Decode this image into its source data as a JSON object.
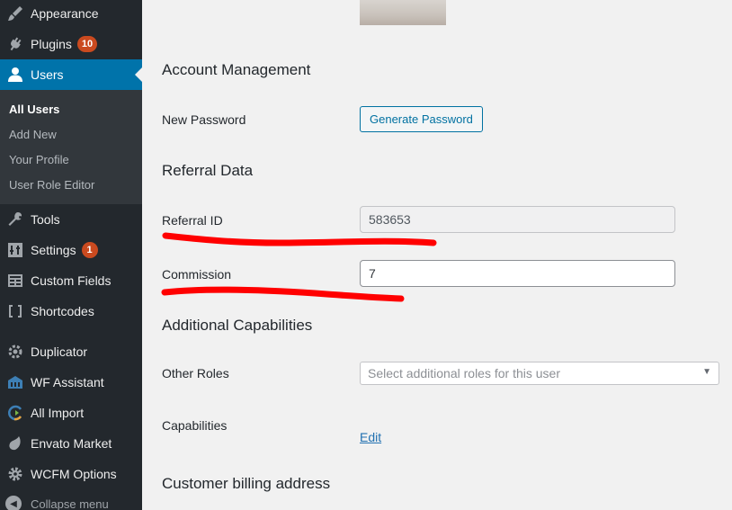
{
  "sidebar": {
    "items": [
      {
        "label": "Appearance",
        "icon": "paintbrush-icon"
      },
      {
        "label": "Plugins",
        "icon": "plugin-icon",
        "badge": "10"
      },
      {
        "label": "Users",
        "icon": "user-icon"
      },
      {
        "label": "Tools",
        "icon": "wrench-icon"
      },
      {
        "label": "Settings",
        "icon": "settings-icon",
        "badge": "1"
      },
      {
        "label": "Custom Fields",
        "icon": "table-icon"
      },
      {
        "label": "Shortcodes",
        "icon": "brackets-icon"
      },
      {
        "label": "Duplicator",
        "icon": "gear-icon"
      },
      {
        "label": "WF Assistant",
        "icon": "building-icon"
      },
      {
        "label": "All Import",
        "icon": "import-icon"
      },
      {
        "label": "Envato Market",
        "icon": "leaf-icon"
      },
      {
        "label": "WCFM Options",
        "icon": "cog-icon"
      }
    ],
    "submenu": [
      "All Users",
      "Add New",
      "Your Profile",
      "User Role Editor"
    ],
    "collapse_label": "Collapse menu"
  },
  "content": {
    "account_heading": "Account Management",
    "new_password_label": "New Password",
    "generate_password_button": "Generate Password",
    "referral_heading": "Referral Data",
    "referral_id_label": "Referral ID",
    "referral_id_value": "583653",
    "commission_label": "Commission",
    "commission_value": "7",
    "capabilities_heading": "Additional Capabilities",
    "other_roles_label": "Other Roles",
    "other_roles_placeholder": "Select additional roles for this user",
    "capabilities_label": "Capabilities",
    "edit_link": "Edit",
    "billing_heading": "Customer billing address"
  },
  "colors": {
    "sidebar_bg": "#23282d",
    "accent": "#0073aa",
    "badge": "#ca4a1f",
    "annotation": "#ff0000"
  }
}
